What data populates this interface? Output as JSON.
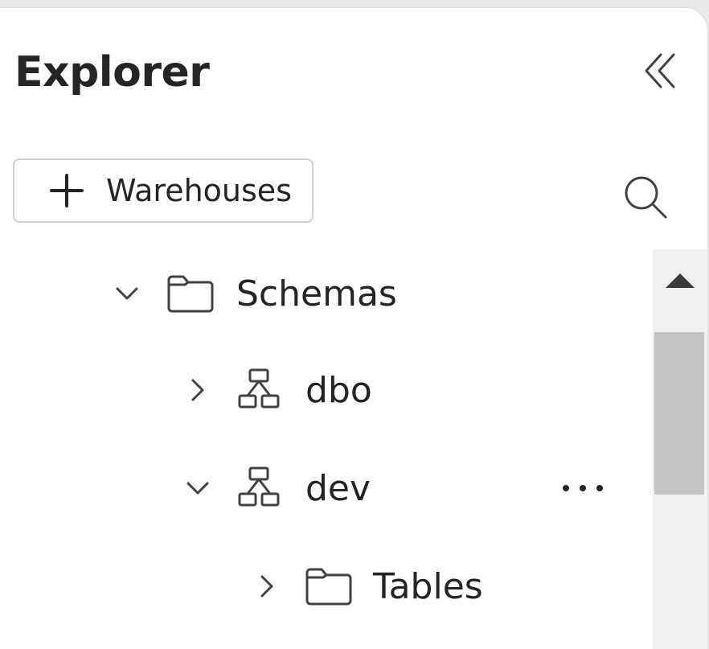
{
  "explorer": {
    "title": "Explorer",
    "collapse_icon": "double-chevron-left-icon",
    "add_button": {
      "icon": "plus-icon",
      "label": "Warehouses"
    },
    "search_icon": "search-icon"
  },
  "tree": {
    "items": [
      {
        "label": "Schemas",
        "expanded": true,
        "icon": "folder-icon",
        "level": 1
      },
      {
        "label": "dbo",
        "expanded": false,
        "icon": "schema-icon",
        "level": 2
      },
      {
        "label": "dev",
        "expanded": true,
        "icon": "schema-icon",
        "level": 2,
        "more_icon": "more-horizontal-icon"
      },
      {
        "label": "Tables",
        "expanded": false,
        "icon": "folder-icon",
        "level": 3
      }
    ]
  },
  "scrollbar": {
    "up_icon": "triangle-up-icon",
    "position_fraction": 0.2
  },
  "colors": {
    "text": "#242424",
    "icon": "#424242",
    "border": "#d1d1d1",
    "scroll_track": "#f0f0f0",
    "scroll_thumb": "#c4c4c4",
    "background": "#ffffff"
  }
}
